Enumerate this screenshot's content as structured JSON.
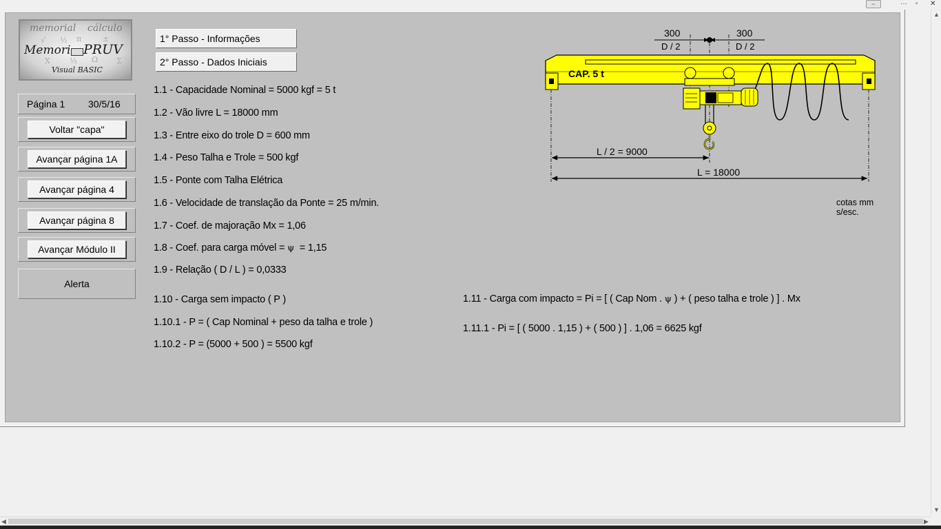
{
  "window": {
    "controls": {
      "more": "···",
      "restore": "▫",
      "close": "✕",
      "resize_icon": "resize-icon"
    }
  },
  "logo": {
    "line1a": "memorial",
    "line1b": "cálculo",
    "line2a": "Memori",
    "line2b": "PRUV",
    "line3": "Visual BASIC"
  },
  "sidebar": {
    "page_label": "Página 1",
    "page_date": "30/5/16",
    "buttons": [
      "Voltar  \"capa\"",
      "Avançar página 1A",
      "Avançar página 4",
      "Avançar página 8",
      "Avançar Módulo II"
    ],
    "alert": "Alerta"
  },
  "steps": {
    "step1": "1° Passo - Informações",
    "step2": "2° Passo  -  Dados Iniciais"
  },
  "lines": [
    "1.1 - Capacidade Nominal = 5000 kgf = 5 t",
    "1.2 - Vão livre   L = 18000 mm",
    "1.3 - Entre eixo do trole   D = 600 mm",
    "1.4 - Peso Talha e Trole = 500 kgf",
    "1.5 - Ponte com Talha Elétrica",
    "1.6 - Velocidade de translação da Ponte = 25 m/min.",
    "1.7 - Coef. de majoração  Mx = 1,06",
    "1.8 - Coef. para carga móvel = ",
    "1.9 - Relação ( D / L ) = 0,0333"
  ],
  "psi": "ψ",
  "line18_value": "= 1,15",
  "impact": {
    "l110": "1.10 - Carga sem impacto ( P )",
    "l1101": "1.10.1 - P = ( Cap Nominal + peso da talha e trole )",
    "l1102": "1.10.2 - P = (5000 + 500 ) = 5500 kgf",
    "l111a": "1.11 - Carga com impacto = Pi = [ ( Cap Nom . ",
    "l111b": " ) + ( peso talha e trole ) ] . Mx",
    "l1111": "1.11.1 - Pi = [ ( 5000 . 1,15 ) + ( 500 ) ] . 1,06 = 6625 kgf"
  },
  "diagram": {
    "dim_left": "300",
    "dim_right": "300",
    "d2_left": "D / 2",
    "d2_right": "D / 2",
    "cap": "CAP. 5 t",
    "half": "L / 2 = 9000",
    "full": "L = 18000",
    "colors": {
      "beam": "#ffff00",
      "outline": "#000000"
    }
  },
  "cotas": {
    "line1": "cotas mm",
    "line2": "s/esc."
  }
}
